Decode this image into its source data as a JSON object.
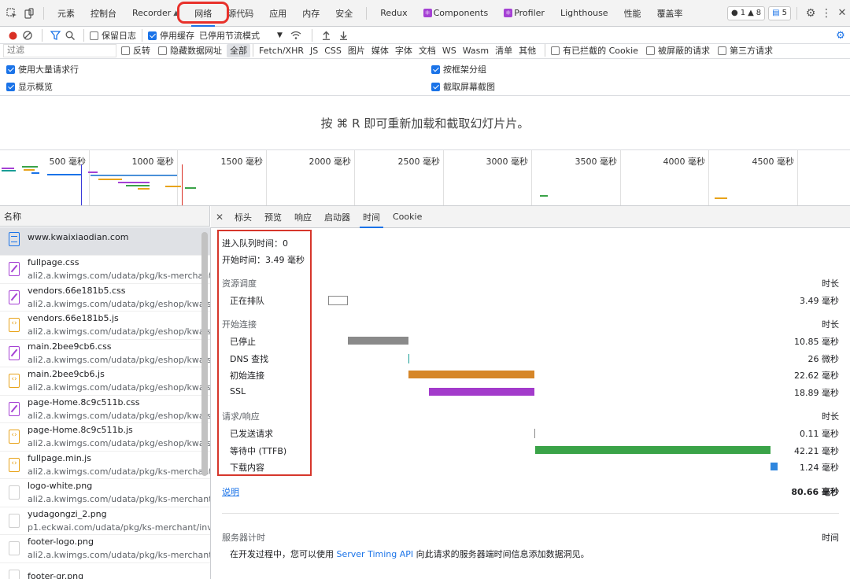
{
  "tabs": {
    "items": [
      "元素",
      "控制台",
      "Recorder",
      "网络",
      "源代码",
      "应用",
      "内存",
      "安全",
      "Redux",
      "Components",
      "Profiler",
      "Lighthouse",
      "性能",
      "覆盖率"
    ],
    "active": "网络"
  },
  "badges": {
    "errors": "1",
    "warnings": "8",
    "messages": "5"
  },
  "toolbar": {
    "preserve_log": "保留日志",
    "disable_cache": "停用缓存",
    "throttling": "已停用节流模式"
  },
  "filter": {
    "placeholder": "过滤",
    "invert": "反转",
    "hide_data_urls": "隐藏数据网址",
    "types": [
      "全部",
      "Fetch/XHR",
      "JS",
      "CSS",
      "图片",
      "媒体",
      "字体",
      "文档",
      "WS",
      "Wasm",
      "清单",
      "其他"
    ],
    "blocked_cookies": "有已拦截的 Cookie",
    "blocked_requests": "被屏蔽的请求",
    "third_party": "第三方请求"
  },
  "options": {
    "big_rows": "使用大量请求行",
    "group_by_frame": "按框架分组",
    "show_overview": "显示概览",
    "capture_screenshots": "截取屏幕截图"
  },
  "overview_message": "按 ⌘ R 即可重新加载和截取幻灯片片。",
  "overview_ticks": [
    "500 毫秒",
    "1000 毫秒",
    "1500 毫秒",
    "2000 毫秒",
    "2500 毫秒",
    "3000 毫秒",
    "3500 毫秒",
    "4000 毫秒",
    "4500 毫秒",
    "5"
  ],
  "list": {
    "header": "名称",
    "rows": [
      {
        "name": "www.kwaixiaodian.com",
        "url": "",
        "type": "doc"
      },
      {
        "name": "fullpage.css",
        "url": "ali2.a.kwimgs.com/udata/pkg/ks-merchant/kw...",
        "type": "css"
      },
      {
        "name": "vendors.66e181b5.css",
        "url": "ali2.a.kwimgs.com/udata/pkg/eshop/kwaisho...",
        "type": "css"
      },
      {
        "name": "vendors.66e181b5.js",
        "url": "ali2.a.kwimgs.com/udata/pkg/eshop/kwaisho...",
        "type": "js"
      },
      {
        "name": "main.2bee9cb6.css",
        "url": "ali2.a.kwimgs.com/udata/pkg/eshop/kwaisho...",
        "type": "css"
      },
      {
        "name": "main.2bee9cb6.js",
        "url": "ali2.a.kwimgs.com/udata/pkg/eshop/kwaisho...",
        "type": "js"
      },
      {
        "name": "page-Home.8c9c511b.css",
        "url": "ali2.a.kwimgs.com/udata/pkg/eshop/kwaisho...",
        "type": "css"
      },
      {
        "name": "page-Home.8c9c511b.js",
        "url": "ali2.a.kwimgs.com/udata/pkg/eshop/kwaisho...",
        "type": "js"
      },
      {
        "name": "fullpage.min.js",
        "url": "ali2.a.kwimgs.com/udata/pkg/ks-merchant/kw...",
        "type": "js"
      },
      {
        "name": "logo-white.png",
        "url": "ali2.a.kwimgs.com/udata/pkg/ks-merchant",
        "type": "img"
      },
      {
        "name": "yudagongzi_2.png",
        "url": "p1.eckwai.com/udata/pkg/ks-merchant/invite_...",
        "type": "img"
      },
      {
        "name": "footer-logo.png",
        "url": "ali2.a.kwimgs.com/udata/pkg/ks-merchant/kw...",
        "type": "img"
      },
      {
        "name": "footer-qr.png",
        "url": "",
        "type": "img"
      }
    ]
  },
  "detail_tabs": {
    "items": [
      "标头",
      "预览",
      "响应",
      "启动器",
      "时间",
      "Cookie"
    ],
    "active": "时间"
  },
  "timing": {
    "queued_at": "进入队列时间：0",
    "started_at": "开始时间：3.49 毫秒",
    "duration_label": "时长",
    "sections": [
      {
        "title": "资源调度",
        "rows": [
          {
            "label": "正在排队",
            "duration": "3.49 毫秒",
            "start_ms": 0,
            "dur_ms": 3.49,
            "color": "#ffffff",
            "outline": true
          }
        ]
      },
      {
        "title": "开始连接",
        "rows": [
          {
            "label": "已停止",
            "duration": "10.85 毫秒",
            "start_ms": 3.49,
            "dur_ms": 10.85,
            "color": "#8a8a8a"
          },
          {
            "label": "DNS 查找",
            "duration": "26 微秒",
            "start_ms": 14.34,
            "dur_ms": 0.026,
            "color": "#1a9e96"
          },
          {
            "label": "初始连接",
            "duration": "22.62 毫秒",
            "start_ms": 14.37,
            "dur_ms": 22.62,
            "color": "#d68628"
          },
          {
            "label": "SSL",
            "duration": "18.89 毫秒",
            "start_ms": 18.1,
            "dur_ms": 18.89,
            "color": "#a33bcb"
          }
        ]
      },
      {
        "title": "请求/响应",
        "rows": [
          {
            "label": "已发送请求",
            "duration": "0.11 毫秒",
            "start_ms": 36.99,
            "dur_ms": 0.11,
            "color": "#8a8a8a"
          },
          {
            "label": "等待中 (TTFB)",
            "duration": "42.21 毫秒",
            "start_ms": 37.1,
            "dur_ms": 42.21,
            "color": "#3aa348"
          },
          {
            "label": "下载内容",
            "duration": "1.24 毫秒",
            "start_ms": 79.31,
            "dur_ms": 1.24,
            "color": "#2e86de"
          }
        ]
      }
    ],
    "explanation": "说明",
    "total": "80.66 毫秒",
    "server_timing": "服务器计时",
    "server_timing_col": "时间",
    "server_timing_note_pre": "在开发过程中，您可以使用",
    "server_timing_link": "Server Timing API",
    "server_timing_note_post": "向此请求的服务器端时间信息添加数据洞见。"
  }
}
